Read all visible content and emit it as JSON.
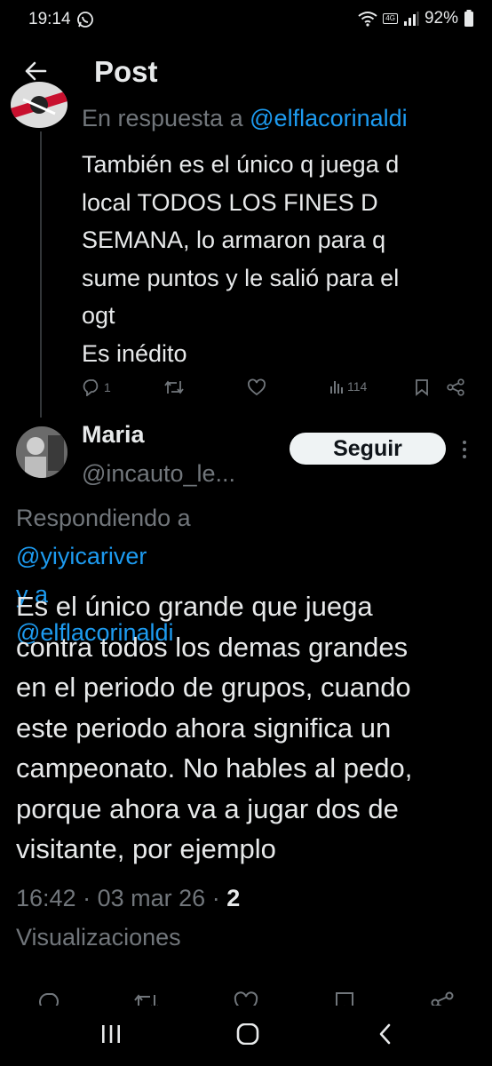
{
  "status_bar": {
    "time": "19:14",
    "volte": "Vo) LTE",
    "network": "4G",
    "battery": "92%"
  },
  "header": {
    "title": "Post"
  },
  "parent_post": {
    "reply_prefix": "En respuesta a",
    "reply_mention": "@elflacorinaldi",
    "text_lines": [
      "También es el único q juega d",
      "local TODOS LOS FINES D",
      "SEMANA, lo armaron para q",
      "sume puntos y le salió para el",
      "ogt",
      "Es inédito"
    ],
    "reply_count": "1",
    "views_count": "114"
  },
  "reply": {
    "author_name": "Maria",
    "author_handle": "@incauto_le...",
    "follow_label": "Seguir",
    "replying_prefix": "Respondiendo a",
    "replying_mention_1": "@yiyicariver",
    "replying_joiner": "y a",
    "replying_mention_2": "@elflacorinaldi",
    "text_lines": [
      "Es el único grande que juega",
      "contra todos los demas grandes",
      "en el periodo de grupos, cuando",
      "este periodo ahora significa un",
      "campeonato. No hables al pedo,",
      "porque ahora va a jugar dos de",
      "visitante, por ejemplo"
    ],
    "time": "16:42",
    "date": "03 mar 26",
    "separator": "·",
    "views_count": "2",
    "views_label": "Visualizaciones"
  },
  "icons": {
    "back": "arrow-left-icon",
    "reply": "speech-bubble-icon",
    "retweet": "retweet-icon",
    "like": "heart-icon",
    "views": "bar-chart-icon",
    "bookmark": "bookmark-icon",
    "share": "share-icon",
    "more": "vertical-dots-icon"
  },
  "colors": {
    "background": "#000000",
    "text": "#e7e9ea",
    "muted": "#71767b",
    "accent": "#1d9bf0",
    "follow_bg": "#eff3f4"
  }
}
